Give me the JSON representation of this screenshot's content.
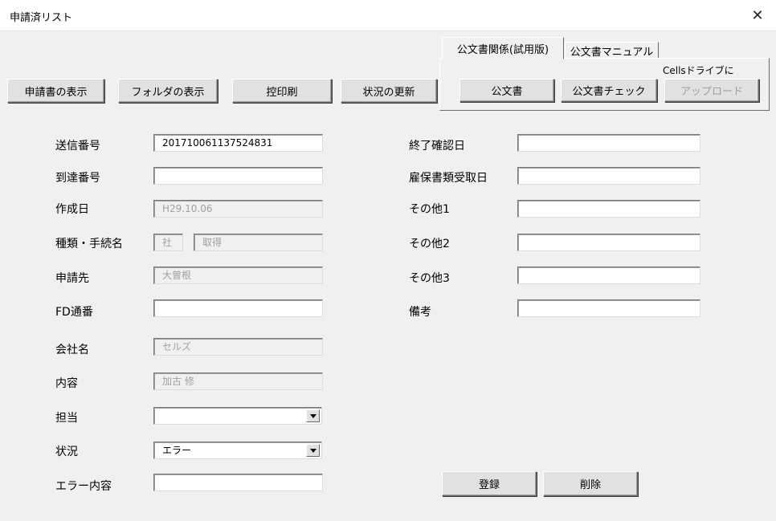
{
  "window": {
    "title": "申請済リスト"
  },
  "toolbar": {
    "show_application": "申請書の表示",
    "show_folder": "フォルダの表示",
    "print_copy": "控印刷",
    "update_status": "状況の更新"
  },
  "tabs": {
    "items": [
      {
        "label": "公文書関係(試用版)"
      },
      {
        "label": "公文書マニュアル"
      }
    ],
    "upload_caption": "Cellsドライブに",
    "public_doc_button": "公文書",
    "doc_check_button": "公文書チェック",
    "upload_button": "アップロード"
  },
  "left_fields": {
    "send_no": {
      "label": "送信番号",
      "value": "201710061137524831"
    },
    "arrival_no": {
      "label": "到達番号",
      "value": ""
    },
    "created_date": {
      "label": "作成日",
      "value": "H29.10.06"
    },
    "type_procedure": {
      "label": "種類・手続名",
      "type_value": "社",
      "procedure_value": "取得"
    },
    "recipient": {
      "label": "申請先",
      "value": "大曽根"
    },
    "fd_no": {
      "label": "FD通番",
      "value": ""
    },
    "company": {
      "label": "会社名",
      "value": "セルズ"
    },
    "content": {
      "label": "内容",
      "value": "加古 修"
    },
    "person": {
      "label": "担当",
      "value": ""
    },
    "status": {
      "label": "状況",
      "value": "エラー"
    },
    "error_content": {
      "label": "エラー内容",
      "value": ""
    }
  },
  "right_fields": {
    "end_confirm_date": {
      "label": "終了確認日",
      "value": ""
    },
    "insurance_received": {
      "label": "雇保書類受取日",
      "value": ""
    },
    "other1": {
      "label": "その他1",
      "value": ""
    },
    "other2": {
      "label": "その他2",
      "value": ""
    },
    "other3": {
      "label": "その他3",
      "value": ""
    },
    "remarks": {
      "label": "備考",
      "value": ""
    }
  },
  "actions": {
    "register": "登録",
    "delete": "削除"
  },
  "icons": {
    "close": "close-icon",
    "dropdown": "chevron-down-icon"
  }
}
